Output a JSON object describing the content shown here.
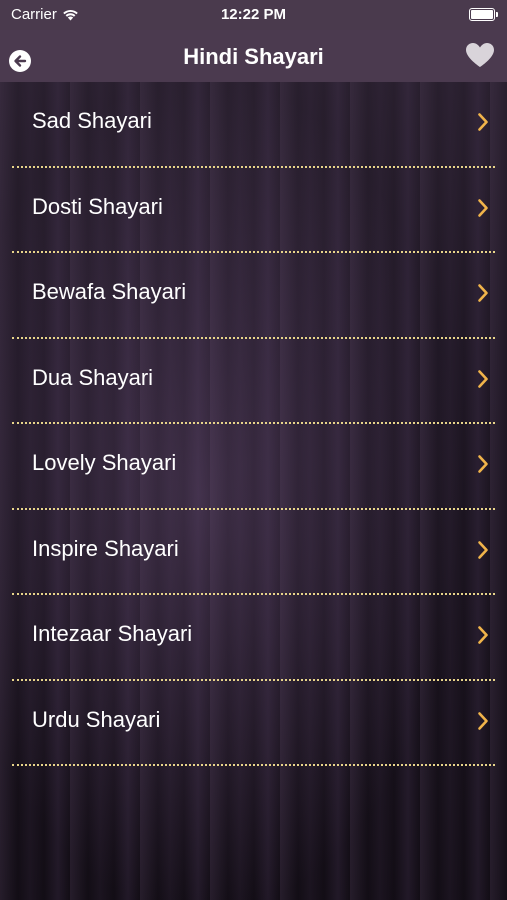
{
  "status_bar": {
    "carrier": "Carrier",
    "time": "12:22 PM"
  },
  "nav": {
    "title": "Hindi Shayari",
    "back_icon": "back-arrow-icon",
    "favorite_icon": "heart-icon"
  },
  "colors": {
    "bar_bg": "#4b3a4f",
    "divider": "#e7d48a",
    "chevron": "#f0b44a",
    "text": "#ffffff"
  },
  "categories": [
    {
      "label": "Sad Shayari"
    },
    {
      "label": "Dosti Shayari"
    },
    {
      "label": "Bewafa Shayari"
    },
    {
      "label": "Dua Shayari"
    },
    {
      "label": "Lovely Shayari"
    },
    {
      "label": "Inspire Shayari"
    },
    {
      "label": "Intezaar Shayari"
    },
    {
      "label": "Urdu Shayari"
    }
  ]
}
